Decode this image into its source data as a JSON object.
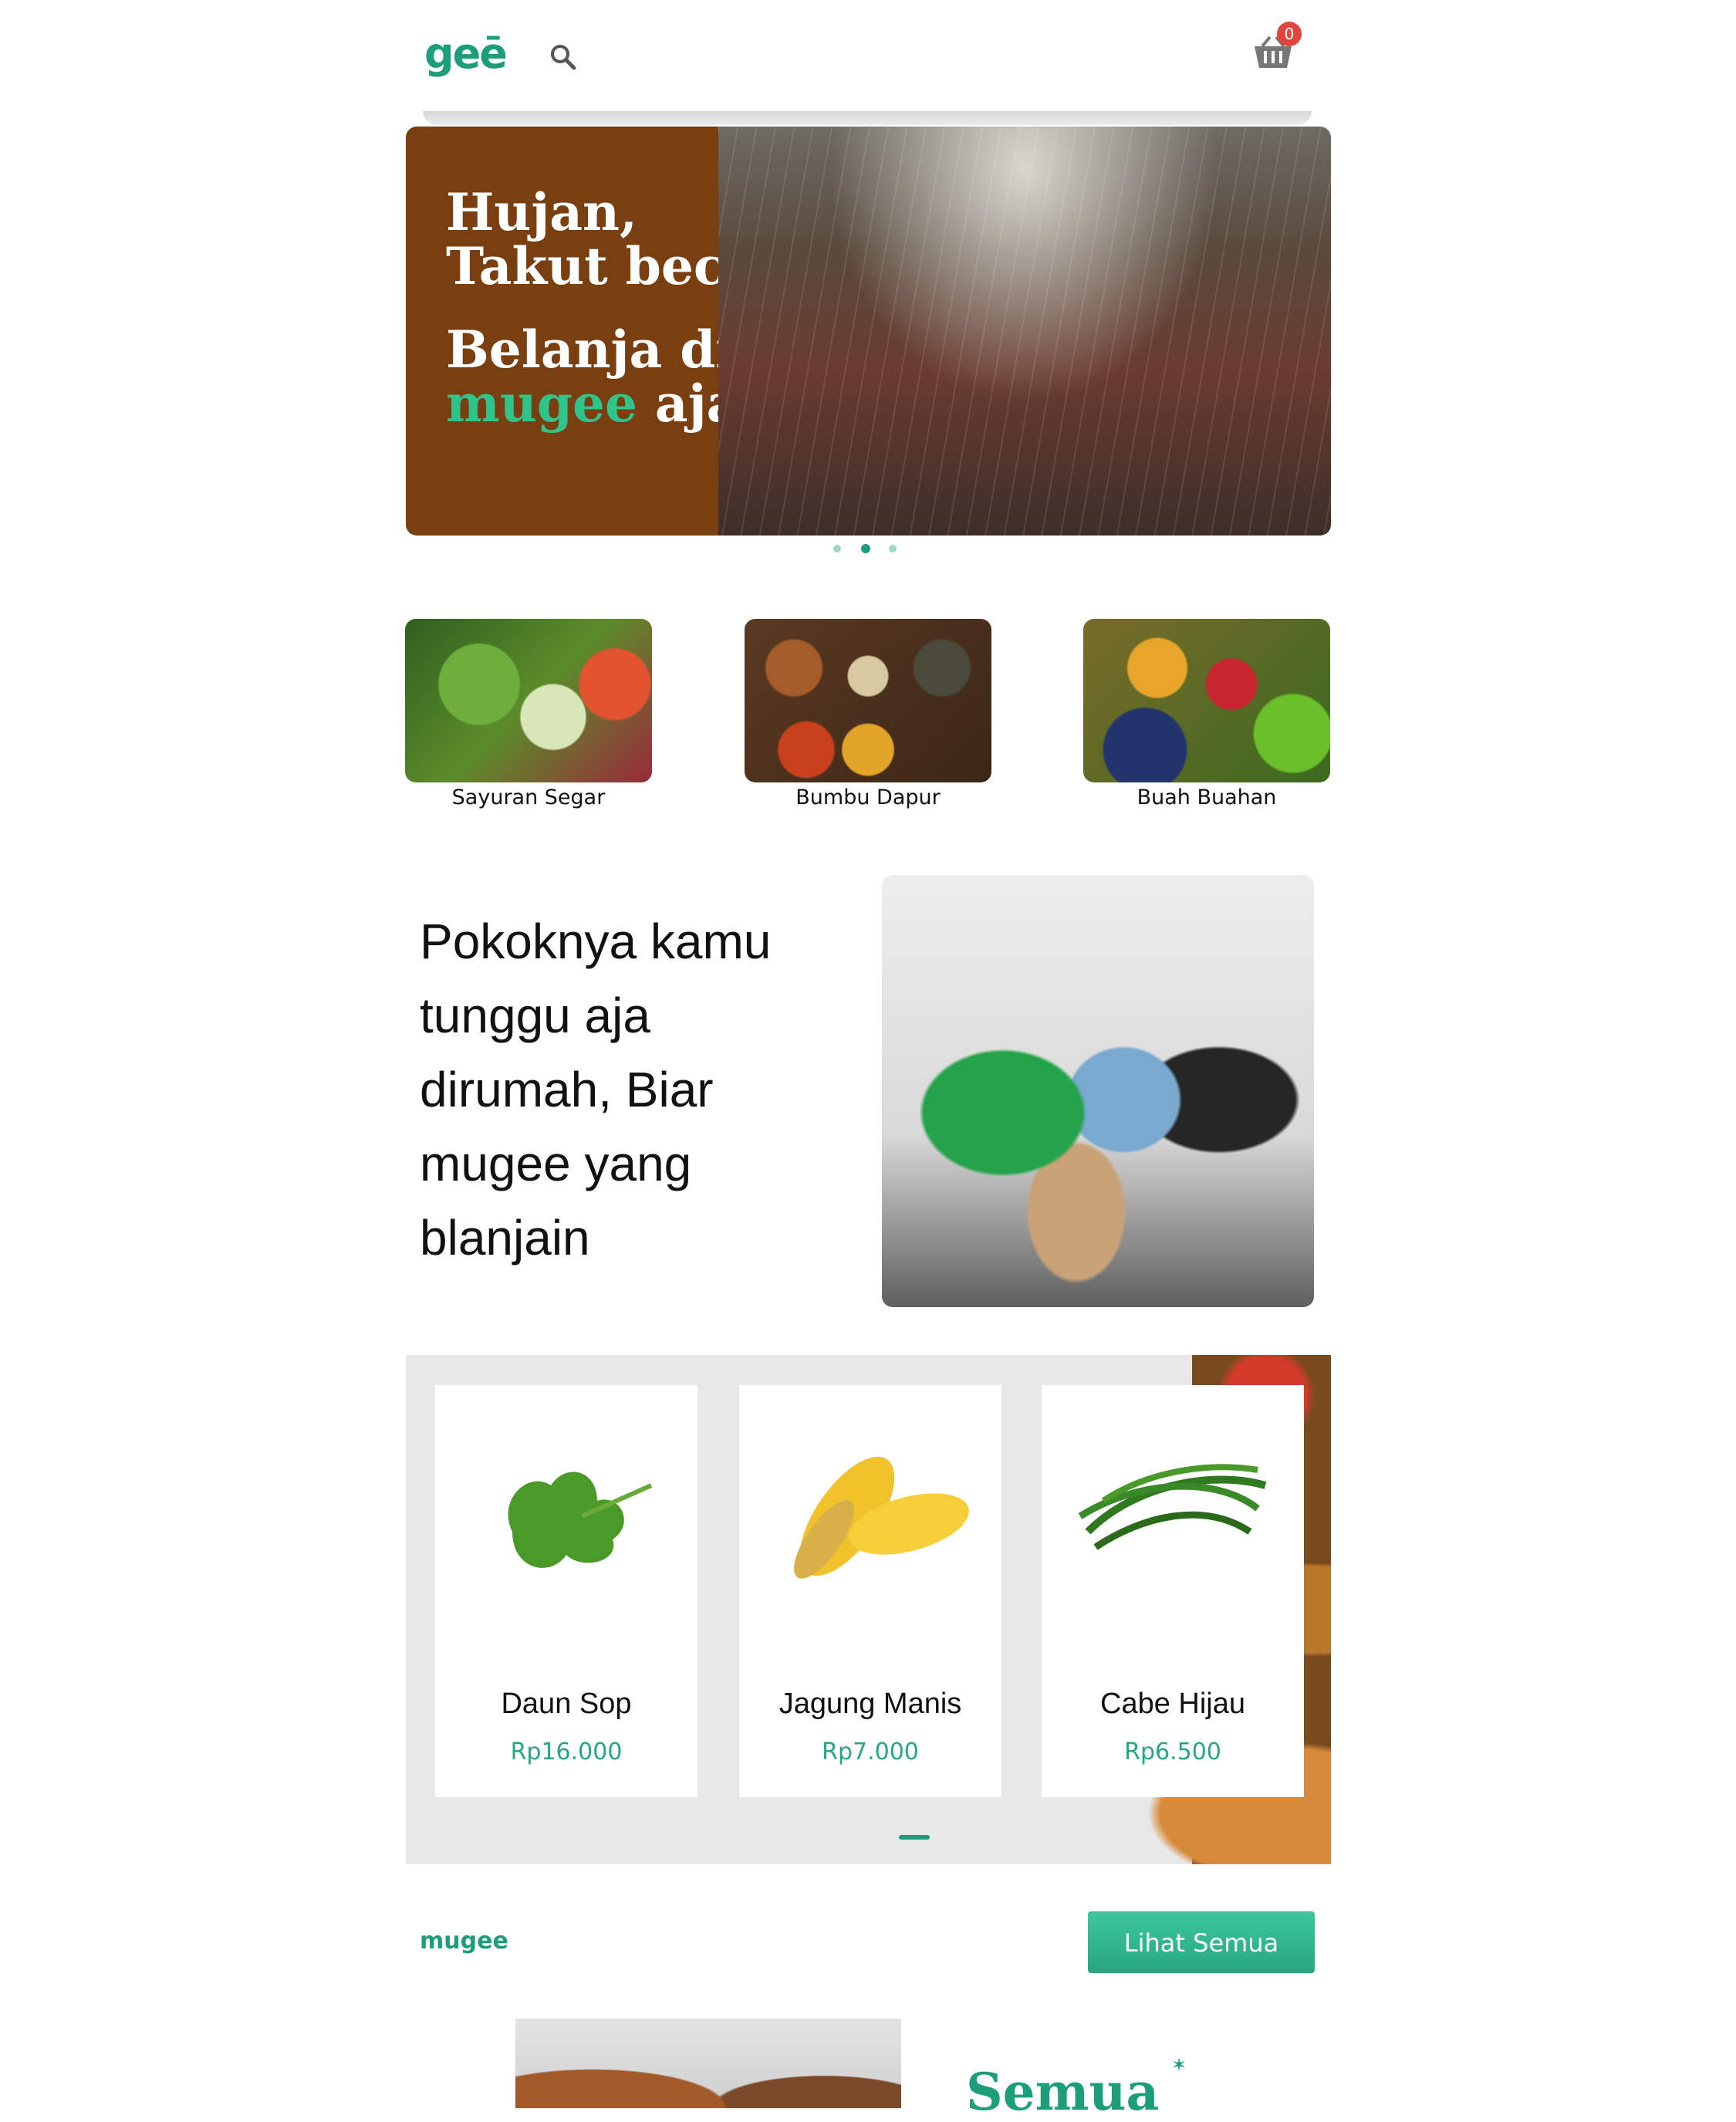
{
  "header": {
    "logo": "geē",
    "cart_count": "0"
  },
  "banner": {
    "line1": "Hujan,",
    "line2": "Takut becek?",
    "line3": "Belanja di",
    "brand": "mugee",
    "line4_rest": " aja",
    "slides": 3,
    "active_slide": 2
  },
  "categories": [
    {
      "label": "Sayuran Segar"
    },
    {
      "label": "Bumbu Dapur"
    },
    {
      "label": "Buah Buahan"
    }
  ],
  "promo": {
    "text": "Pokoknya kamu tunggu aja dirumah, Biar mugee yang blanjain"
  },
  "products": [
    {
      "name": "Daun Sop",
      "price": "Rp16.000"
    },
    {
      "name": "Jagung Manis",
      "price": "Rp7.000"
    },
    {
      "name": "Cabe Hijau",
      "price": "Rp6.500"
    }
  ],
  "footer": {
    "mini_logo": "mugee",
    "see_all_label": "Lihat Semua"
  },
  "teaser": {
    "title": "Semua"
  },
  "colors": {
    "brand": "#1b9e79",
    "banner_bg": "#7a3f10",
    "badge": "#e0463e"
  }
}
